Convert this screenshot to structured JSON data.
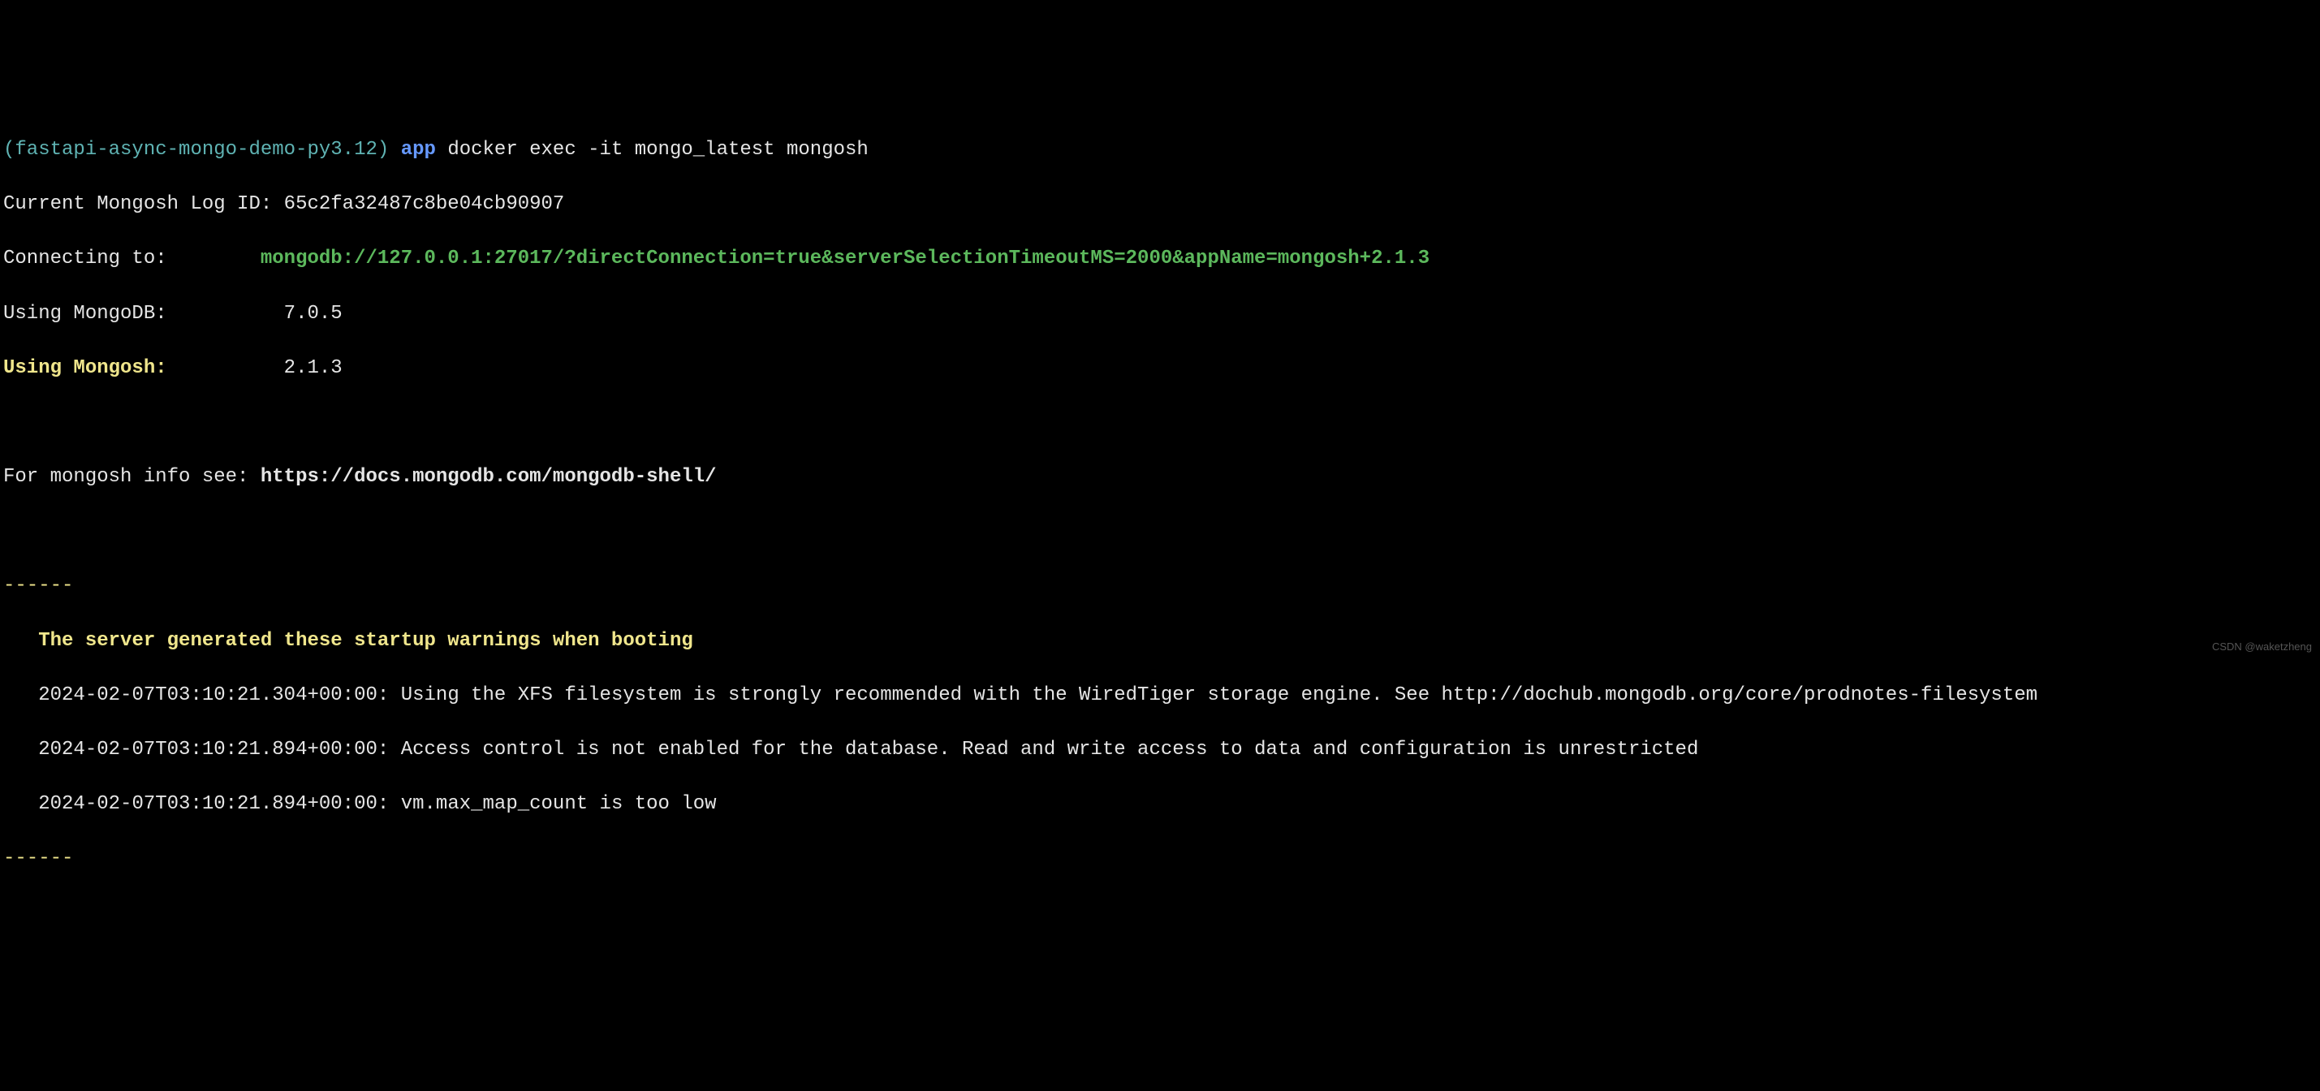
{
  "prompt": {
    "env": "(fastapi-async-mongo-demo-py3.12)",
    "dir": "app",
    "command": "docker exec -it mongo_latest mongosh"
  },
  "log_id": {
    "label": "Current Mongosh Log ID:",
    "value": "65c2fa32487c8be04cb90907"
  },
  "connecting": {
    "label": "Connecting to:",
    "value": "mongodb://127.0.0.1:27017/?directConnection=true&serverSelectionTimeoutMS=2000&appName=mongosh+2.1.3"
  },
  "mongodb_version": {
    "label": "Using MongoDB:",
    "value": "7.0.5"
  },
  "mongosh_version": {
    "label": "Using Mongosh:",
    "value": "2.1.3"
  },
  "info": {
    "prefix": "For mongosh info see: ",
    "url": "https://docs.mongodb.com/mongodb-shell/"
  },
  "divider": "------",
  "warnings": {
    "header": "The server generated these startup warnings when booting",
    "items": [
      {
        "timestamp": "2024-02-07T03:10:21.304+00:00:",
        "message": "Using the XFS filesystem is strongly recommended with the WiredTiger storage engine. See http://dochub.mongodb.org/core/prodnotes-filesystem"
      },
      {
        "timestamp": "2024-02-07T03:10:21.894+00:00:",
        "message": "Access control is not enabled for the database. Read and write access to data and configuration is unrestricted"
      },
      {
        "timestamp": "2024-02-07T03:10:21.894+00:00:",
        "message": "vm.max_map_count is too low"
      }
    ]
  },
  "watermark": "CSDN @waketzheng"
}
